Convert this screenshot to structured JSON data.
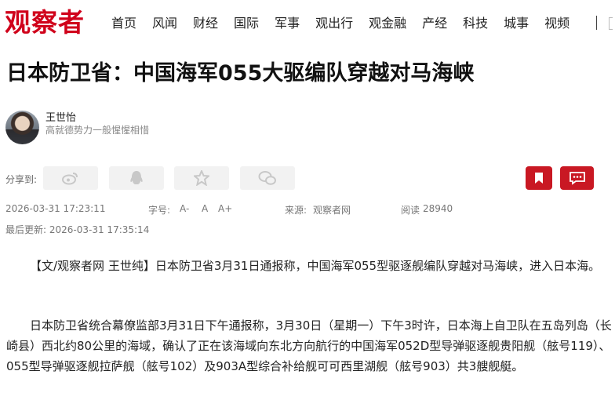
{
  "header": {
    "logo": "观察者",
    "nav": [
      "首页",
      "风闻",
      "财经",
      "国际",
      "军事",
      "观出行",
      "观金融",
      "产经",
      "科技",
      "城事",
      "视频"
    ]
  },
  "article": {
    "title": "日本防卫省：中国海军055大驱编队穿越对马海峡",
    "author": {
      "name": "王世怡",
      "desc": "高就德势力一般惺惺相惜"
    },
    "share_label": "分享到:",
    "share_icons": [
      "weibo-icon",
      "qq-icon",
      "qzone-star-icon",
      "wechat-icon"
    ],
    "action_icons": [
      "bookmark-icon",
      "comment-icon"
    ],
    "published": "2026-03-31 17:23:11",
    "font_size_label": "字号:",
    "font_sizes": [
      "A-",
      "A",
      "A+"
    ],
    "source_label": "来源:",
    "source": "观察者网",
    "read_label": "阅读",
    "read_count": "28940",
    "updated_label": "最后更新:",
    "updated": "2026-03-31 17:35:14",
    "paragraphs": [
      "【文/观察者网 王世纯】日本防卫省3月31日通报称，中国海军055型驱逐舰编队穿越对马海峡，进入日本海。",
      "日本防卫省统合幕僚监部3月31日下午通报称，3月30日（星期一）下午3时许，日本海上自卫队在五岛列岛（长崎县）西北约80公里的海域，确认了正在该海域向东北方向航行的中国海军052D型导弹驱逐舰贵阳舰（舷号119）、055型导弹驱逐舰拉萨舰（舷号102）及903A型综合补给舰可可西里湖舰（舷号903）共3艘舰艇。"
    ]
  },
  "colors": {
    "brand_red": "#d0021b",
    "button_red": "#c91823",
    "share_bg": "#f2f2f2"
  }
}
